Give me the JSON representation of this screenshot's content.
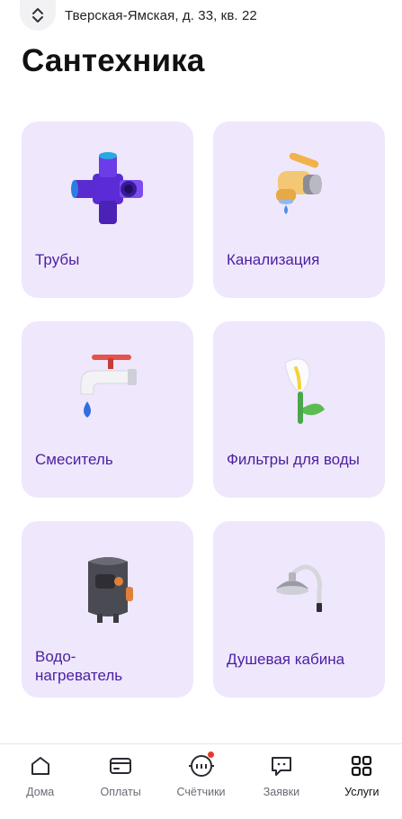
{
  "header": {
    "address": "Тверская-Ямская, д. 33, кв. 22"
  },
  "page": {
    "title": "Сантехника"
  },
  "services": [
    {
      "label": "Трубы",
      "icon": "pipe-fitting-icon"
    },
    {
      "label": "Канализация",
      "icon": "drain-valve-icon"
    },
    {
      "label": "Смеситель",
      "icon": "faucet-icon"
    },
    {
      "label": "Фильтры для воды",
      "icon": "calla-lily-icon"
    },
    {
      "label": "Водо-\nнагреватель",
      "icon": "water-heater-icon"
    },
    {
      "label": "Душевая кабина",
      "icon": "shower-head-icon"
    }
  ],
  "tabbar": {
    "items": [
      {
        "label": "Дома",
        "icon": "home-icon",
        "active": false
      },
      {
        "label": "Оплаты",
        "icon": "card-icon",
        "active": false
      },
      {
        "label": "Счётчики",
        "icon": "meter-icon",
        "active": false,
        "badge": true
      },
      {
        "label": "Заявки",
        "icon": "chat-icon",
        "active": false
      },
      {
        "label": "Услуги",
        "icon": "grid-icon",
        "active": true
      }
    ]
  },
  "colors": {
    "tile_background": "#efe7fb",
    "tile_label": "#4b1fa3",
    "badge": "#e83a2c"
  }
}
